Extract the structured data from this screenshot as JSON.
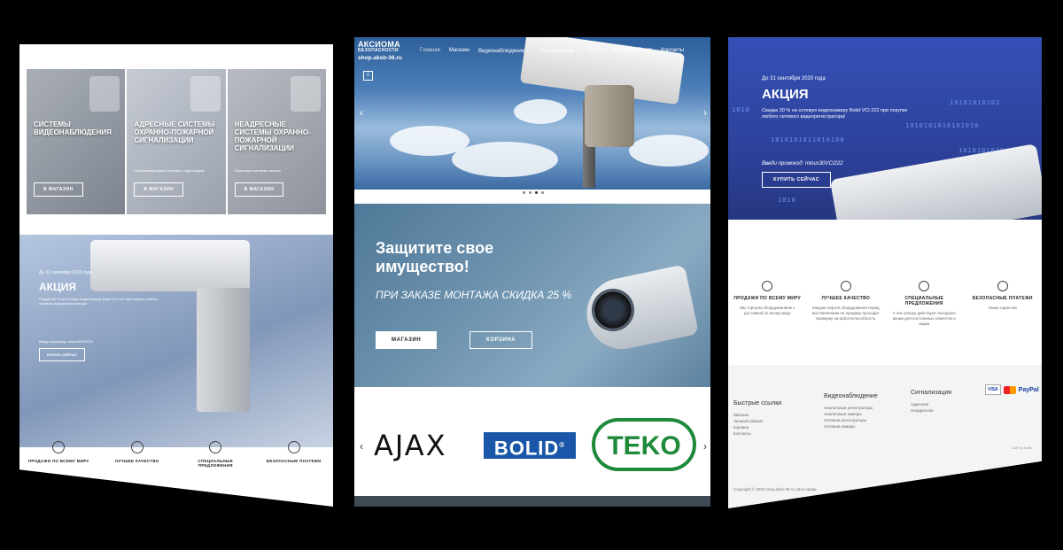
{
  "left": {
    "tiles": [
      {
        "title": "Системы видеонаблюдения",
        "sub": "",
        "button": "В МАГАЗИН"
      },
      {
        "title": "Адресные системы охранно-пожарной сигнализации",
        "sub": "Сигнализационные системы с адресацией",
        "button": "В МАГАЗИН"
      },
      {
        "title": "Неадресные системы охранно-пожарной сигнализации",
        "sub": "Пороговые системы охраны",
        "button": "В МАГАЗИН"
      }
    ],
    "promo": {
      "date": "До 31 сентября 2020 года",
      "title": "АКЦИЯ",
      "text": "Скидка 30 % на сетевую видеокамеру Bolid VCI 222 при покупке любого сетевого видеорегистратора!",
      "promo_line": "Введи промокод: minus30VCI222",
      "button": "КУПИТЬ СЕЙЧАС"
    },
    "features": [
      {
        "icon": "globe-icon",
        "label": "ПРОДАЖИ ПО ВСЕМУ МИРУ"
      },
      {
        "icon": "quality-icon",
        "label": "ЛУЧШЕЕ КАЧЕСТВО"
      },
      {
        "icon": "offer-icon",
        "label": "СПЕЦИАЛЬНЫЕ ПРЕДЛОЖЕНИЯ"
      },
      {
        "icon": "lock-icon",
        "label": "БЕЗОПАСНЫЕ ПЛАТЕЖИ"
      }
    ]
  },
  "center": {
    "brand": {
      "name": "АКСИОМА",
      "sub": "БЕЗОПАСНОСТИ",
      "url": "shop.aksb-36.ru"
    },
    "nav": [
      "Главная",
      "Магазин",
      "Видеонаблюдение ⌄",
      "Сигнализация ⌄",
      "О нас",
      "Личный кабинет",
      "Контакты"
    ],
    "cart_count": "0",
    "arrows": {
      "prev": "‹",
      "next": "›"
    },
    "banner": {
      "title": "Защитите свое имущество!",
      "subtitle": "ПРИ ЗАКАЗЕ МОНТАЖА СКИДКА 25 %",
      "btn_shop": "МАГАЗИН",
      "btn_cart": "КОРЗИНА"
    },
    "logos": {
      "ajax": "AJAX",
      "bolid": "BOLID",
      "bolid_mark": "®",
      "teko": "TEKO"
    }
  },
  "right": {
    "promo": {
      "date": "До 31 сентября 2020 года",
      "title": "АКЦИЯ",
      "text": "Скидка 30 % на сетевую видеокамеру Bolid VCI 222 при покупке любого сетевого видеорегистратора!",
      "promo_line": "Введи промокод: minus30VCI222",
      "button": "КУПИТЬ СЕЙЧАС",
      "binary": [
        "1010",
        "10101010101",
        "1010101010101010",
        "1010101011010100",
        "1010101010",
        "1010"
      ]
    },
    "features": [
      {
        "icon": "globe-icon",
        "label": "ПРОДАЖИ ПО ВСЕМУ МИРУ",
        "desc": "Мы торгуем оборудованием с доставкой по всему миру"
      },
      {
        "icon": "quality-icon",
        "label": "ЛУЧШЕЕ КАЧЕСТВО",
        "desc": "Каждая партия оборудования перед выставлением на продажу проходит проверку на работоспособность"
      },
      {
        "icon": "offer-icon",
        "label": "СПЕЦИАЛЬНЫЕ ПРЕДЛОЖЕНИЯ",
        "desc": "У нас всегда действуют выгодные акции для постоянных клиентов и акции"
      },
      {
        "icon": "lock-icon",
        "label": "БЕЗОПАСНЫЕ ПЛАТЕЖИ",
        "desc": "Наши гарантии"
      }
    ],
    "footer": {
      "col1": {
        "title": "Быстрые ссылки",
        "links": [
          "Магазин",
          "Личный кабинет",
          "Корзина",
          "Контакты"
        ]
      },
      "col2": {
        "title": "Видеонаблюдение",
        "links": [
          "Аналоговые регистраторы",
          "Аналоговые камеры",
          "Сетевые регистраторы",
          "Сетевые камеры"
        ]
      },
      "col3": {
        "title": "Сигнализация",
        "links": [
          "Адресная",
          "Неадресная"
        ]
      },
      "pay": {
        "visa": "VISA",
        "paypal": "PayPal"
      },
      "copyright": "Copyright © 2020 shop.aksb-36.ru | Все права",
      "made": "Сайт by Kartik"
    }
  }
}
